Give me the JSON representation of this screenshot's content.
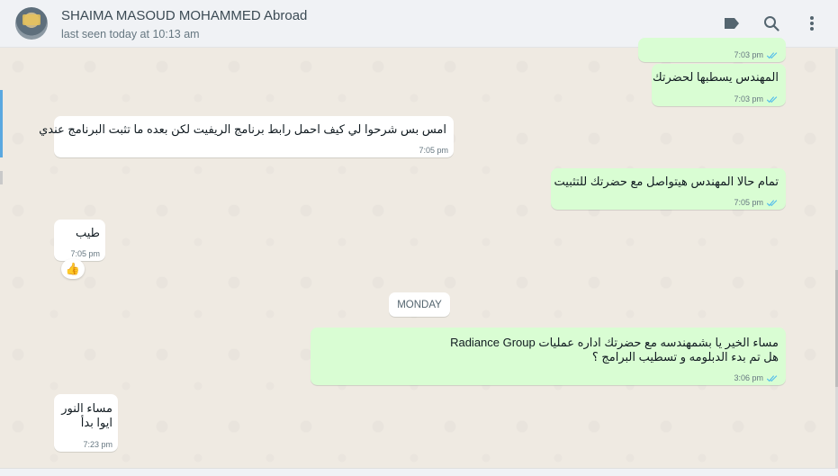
{
  "header": {
    "contact_name": "SHAIMA MASOUD MOHAMMED Abroad",
    "contact_status": "last seen today at 10:13 am",
    "icons": [
      "label-icon",
      "search-icon",
      "menu-icon"
    ]
  },
  "colors": {
    "outgoing_bubble": "#d9fdd3",
    "incoming_bubble": "#ffffff",
    "read_tick": "#53bdeb",
    "chat_background": "#efeae2"
  },
  "day_separator": "MONDAY",
  "messages": [
    {
      "direction": "out",
      "lines": [],
      "time": "7:03 pm",
      "status": "read"
    },
    {
      "direction": "out",
      "lines": [
        "المهندس يسطبها لحضرتك"
      ],
      "time": "7:03 pm",
      "status": "read"
    },
    {
      "direction": "in",
      "lines": [
        "امس بس شرحوا لي كيف احمل رابط برنامج الريفيت لكن بعده ما تثبت البرنامج عندي"
      ],
      "time": "7:05 pm"
    },
    {
      "direction": "out",
      "lines": [
        "تمام حالا المهندس هيتواصل مع حضرتك للتثبيت"
      ],
      "time": "7:05 pm",
      "status": "read"
    },
    {
      "direction": "in",
      "lines": [
        "طيب"
      ],
      "time": "7:05 pm",
      "reaction": "👍"
    },
    {
      "direction": "out",
      "lines": [
        "مساء الخير يا بشمهندسه  مع حضرتك اداره عمليات Radiance Group",
        "هل تم بدء الدبلومه و تسطيب البرامج  ؟"
      ],
      "time": "3:06 pm",
      "status": "read"
    },
    {
      "direction": "in",
      "lines": [
        "مساء النور",
        "ايوا بدأ"
      ],
      "time": "7:23 pm"
    }
  ]
}
